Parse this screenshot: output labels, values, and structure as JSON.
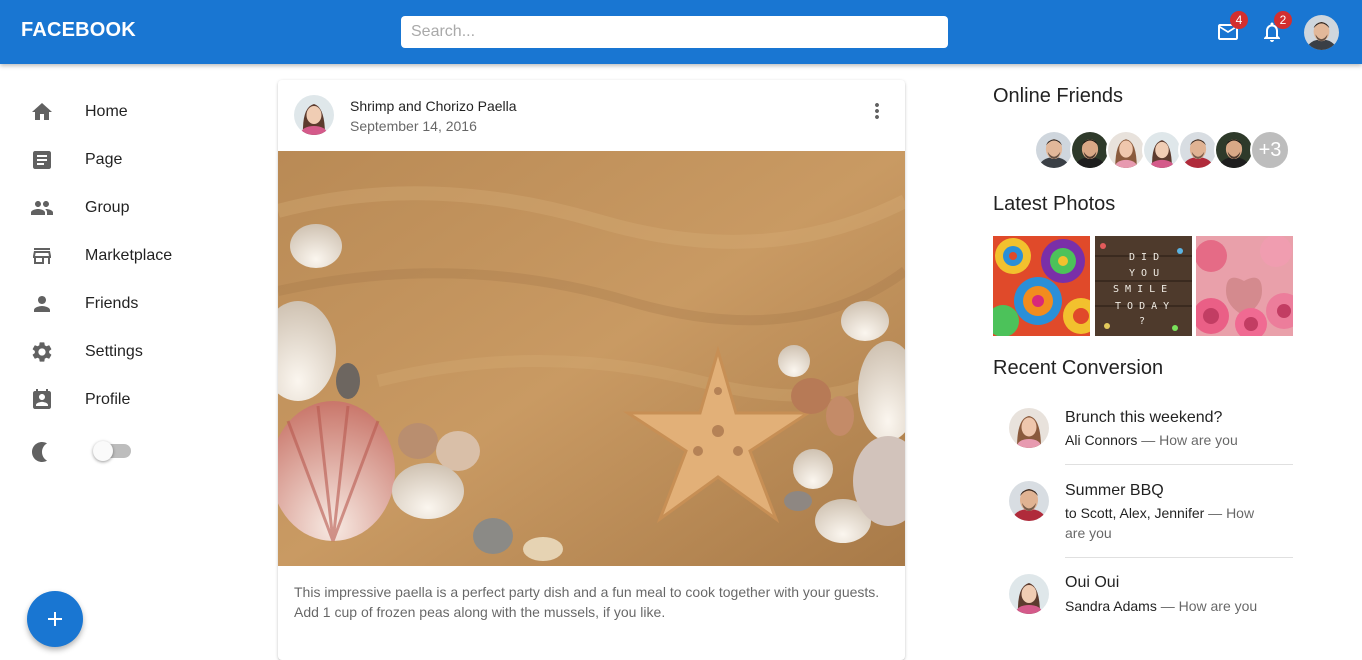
{
  "appbar": {
    "brand": "FACEBOOK",
    "search_placeholder": "Search...",
    "mail_badge": "4",
    "notifications_badge": "2",
    "accent_color": "#1976d2"
  },
  "sidebar": {
    "items": [
      {
        "label": "Home",
        "icon": "home-icon"
      },
      {
        "label": "Page",
        "icon": "page-icon"
      },
      {
        "label": "Group",
        "icon": "group-icon"
      },
      {
        "label": "Marketplace",
        "icon": "store-icon"
      },
      {
        "label": "Friends",
        "icon": "person-icon"
      },
      {
        "label": "Settings",
        "icon": "gear-icon"
      },
      {
        "label": "Profile",
        "icon": "profile-badge-icon"
      }
    ],
    "dark_mode_icon": "moon-icon",
    "dark_mode_on": false,
    "fab_icon": "plus-icon"
  },
  "post": {
    "title": "Shrimp and Chorizo Paella",
    "date": "September 14, 2016",
    "text": "This impressive paella is a perfect party dish and a fun meal to cook together with your guests. Add 1 cup of frozen peas along with the mussels, if you like.",
    "menu_icon": "more-vert-icon"
  },
  "right": {
    "online_title": "Online Friends",
    "online_more": "+3",
    "photos_title": "Latest Photos",
    "conversations_title": "Recent Conversion",
    "conversations": [
      {
        "title": "Brunch this weekend?",
        "sender": "Ali Connors",
        "message": " — How are you"
      },
      {
        "title": "Summer BBQ",
        "sender": "to Scott, Alex, Jennifer",
        "message": " — How are you"
      },
      {
        "title": "Oui Oui",
        "sender": "Sandra Adams",
        "message": " — How are you"
      }
    ]
  }
}
